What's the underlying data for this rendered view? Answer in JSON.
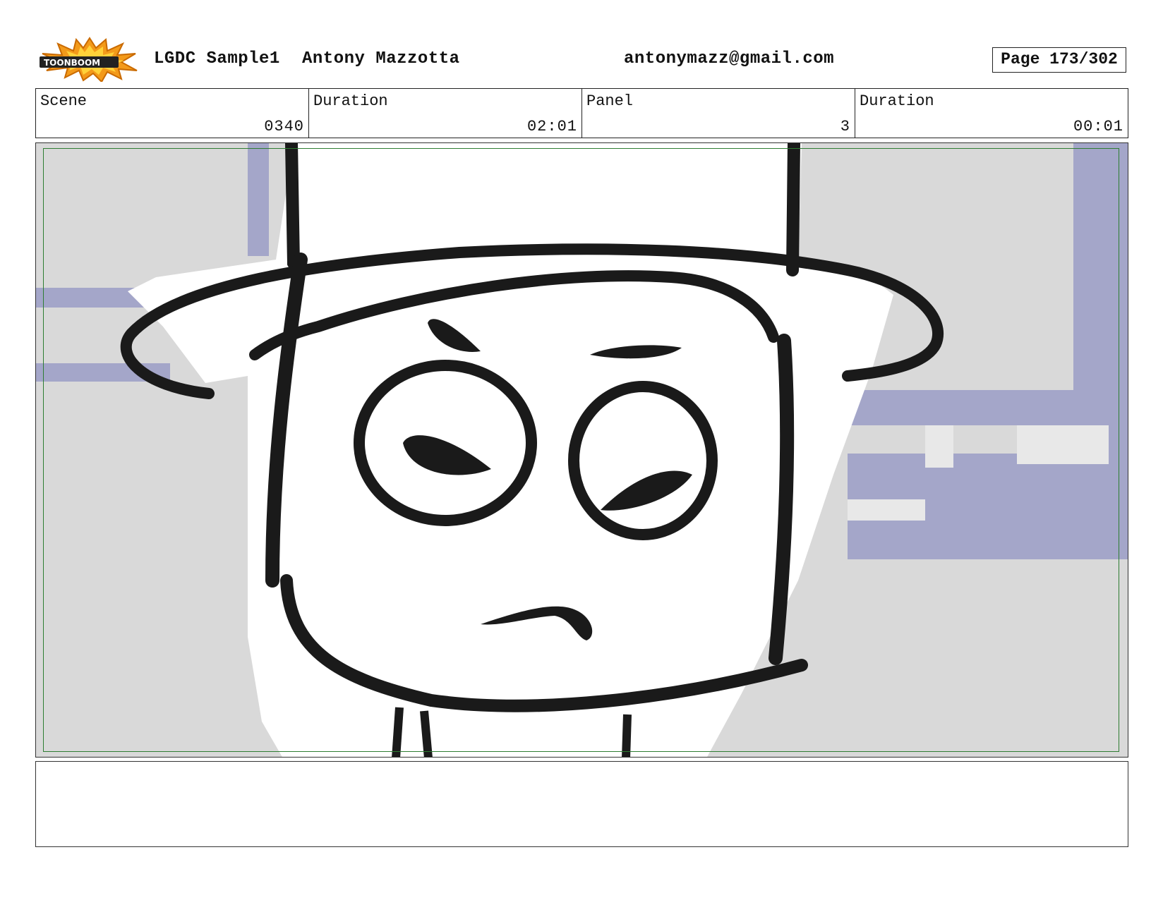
{
  "header": {
    "logo_text": "TOONBOOM",
    "project_title": "LGDC Sample1",
    "author": "Antony Mazzotta",
    "email": "antonymazz@gmail.com",
    "page_label": "Page 173/302"
  },
  "info": {
    "scene_label": "Scene",
    "scene_value": "0340",
    "scene_duration_label": "Duration",
    "scene_duration_value": "02:01",
    "panel_label": "Panel",
    "panel_value": "3",
    "panel_duration_label": "Duration",
    "panel_duration_value": "00:01"
  },
  "colors": {
    "background_gray": "#d9d9d9",
    "stripe_blue": "#a4a6c9",
    "ink": "#1a1a1a",
    "safe_frame": "#2e7d32",
    "logo_orange": "#f39a1a"
  },
  "notes": {
    "text": ""
  }
}
